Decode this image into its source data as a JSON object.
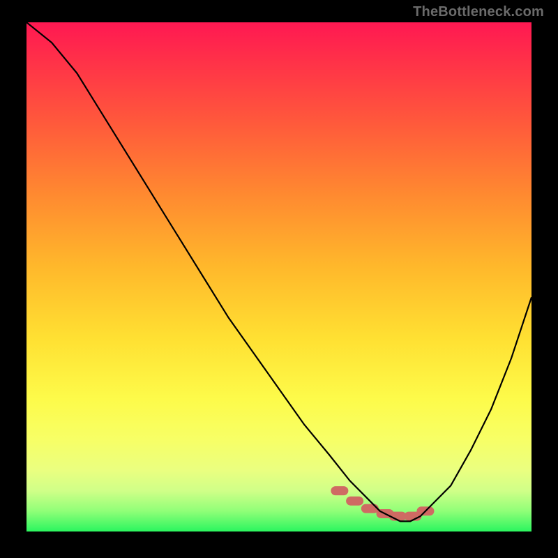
{
  "attribution": "TheBottleneck.com",
  "chart_data": {
    "type": "line",
    "title": "",
    "xlabel": "",
    "ylabel": "",
    "xlim": [
      0,
      100
    ],
    "ylim": [
      0,
      100
    ],
    "grid": false,
    "legend": false,
    "note": "Axes are unlabeled in the source image; values are read as percentage of plot area (0 = left/bottom, 100 = right/top). The curve starts near the top-left, descends nearly linearly to a minimum around x≈72, and rises steeply toward x=100.",
    "series": [
      {
        "name": "bottleneck-curve",
        "x": [
          0,
          5,
          10,
          15,
          20,
          25,
          30,
          35,
          40,
          45,
          50,
          55,
          60,
          64,
          68,
          70,
          72,
          74,
          76,
          78,
          80,
          84,
          88,
          92,
          96,
          100
        ],
        "values": [
          100,
          96,
          90,
          82,
          74,
          66,
          58,
          50,
          42,
          35,
          28,
          21,
          15,
          10,
          6,
          4,
          3,
          2,
          2,
          3,
          5,
          9,
          16,
          24,
          34,
          46
        ]
      }
    ],
    "markers": {
      "note": "Pink segmented blobs along the minimum region of the curve.",
      "x": [
        62,
        65,
        68,
        71,
        73.5,
        76.5,
        79
      ],
      "values": [
        8,
        6,
        4.5,
        3.5,
        3,
        3,
        4
      ]
    },
    "background_gradient": {
      "direction": "top-to-bottom",
      "stops": [
        {
          "pos": 0.0,
          "color": "#ff1852"
        },
        {
          "pos": 0.07,
          "color": "#ff2f49"
        },
        {
          "pos": 0.2,
          "color": "#ff5a3b"
        },
        {
          "pos": 0.34,
          "color": "#ff8a30"
        },
        {
          "pos": 0.48,
          "color": "#ffb82b"
        },
        {
          "pos": 0.62,
          "color": "#ffe032"
        },
        {
          "pos": 0.74,
          "color": "#fdfb4a"
        },
        {
          "pos": 0.82,
          "color": "#f7ff66"
        },
        {
          "pos": 0.88,
          "color": "#eaff80"
        },
        {
          "pos": 0.92,
          "color": "#d0ff88"
        },
        {
          "pos": 0.96,
          "color": "#90ff78"
        },
        {
          "pos": 1.0,
          "color": "#2bf55f"
        }
      ]
    }
  }
}
